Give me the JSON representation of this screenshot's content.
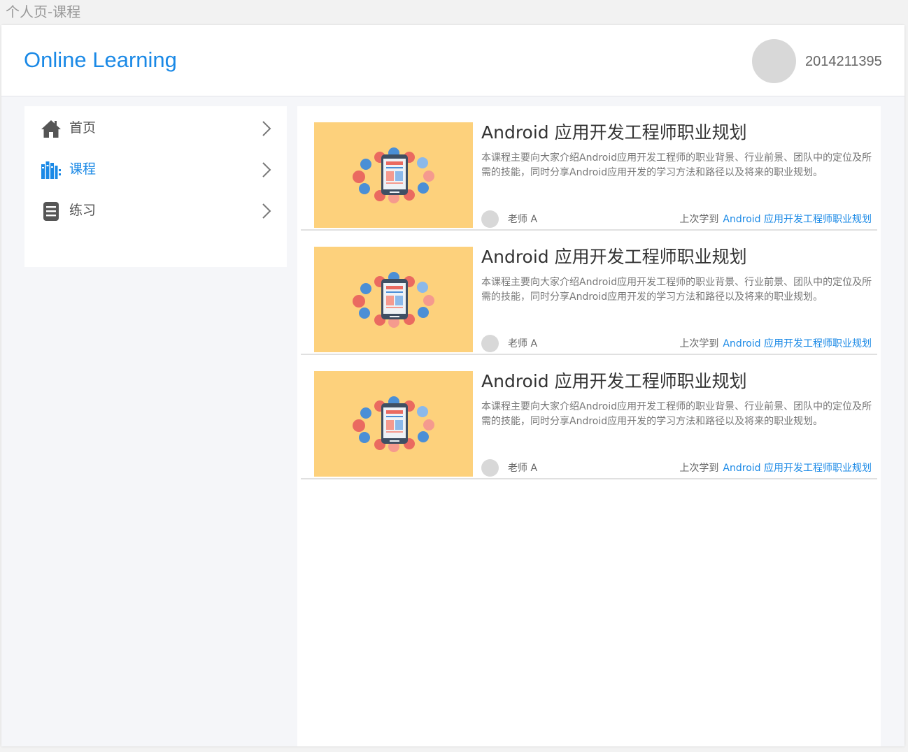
{
  "page_label": "个人页-课程",
  "header": {
    "brand": "Online Learning",
    "username": "2014211395"
  },
  "colors": {
    "accent": "#1a89e6",
    "thumb_bg": "#fdd17c",
    "avatar_gray": "#d8d8d8"
  },
  "sidebar": {
    "items": [
      {
        "label": "首页",
        "icon": "home-icon",
        "active": false
      },
      {
        "label": "课程",
        "icon": "books-icon",
        "active": true
      },
      {
        "label": "练习",
        "icon": "list-icon",
        "active": false
      }
    ]
  },
  "courses": [
    {
      "title": "Android 应用开发工程师职业规划",
      "description": "本课程主要向大家介绍Android应用开发工程师的职业背景、行业前景、团队中的定位及所需的技能，同时分享Android应用开发的学习方法和路径以及将来的职业规划。",
      "teacher": "老师 A",
      "last_label": "上次学到",
      "last_link": "Android 应用开发工程师职业规划"
    },
    {
      "title": "Android 应用开发工程师职业规划",
      "description": "本课程主要向大家介绍Android应用开发工程师的职业背景、行业前景、团队中的定位及所需的技能，同时分享Android应用开发的学习方法和路径以及将来的职业规划。",
      "teacher": "老师 A",
      "last_label": "上次学到",
      "last_link": "Android 应用开发工程师职业规划"
    },
    {
      "title": "Android 应用开发工程师职业规划",
      "description": "本课程主要向大家介绍Android应用开发工程师的职业背景、行业前景、团队中的定位及所需的技能，同时分享Android应用开发的学习方法和路径以及将来的职业规划。",
      "teacher": "老师 A",
      "last_label": "上次学到",
      "last_link": "Android 应用开发工程师职业规划"
    }
  ]
}
